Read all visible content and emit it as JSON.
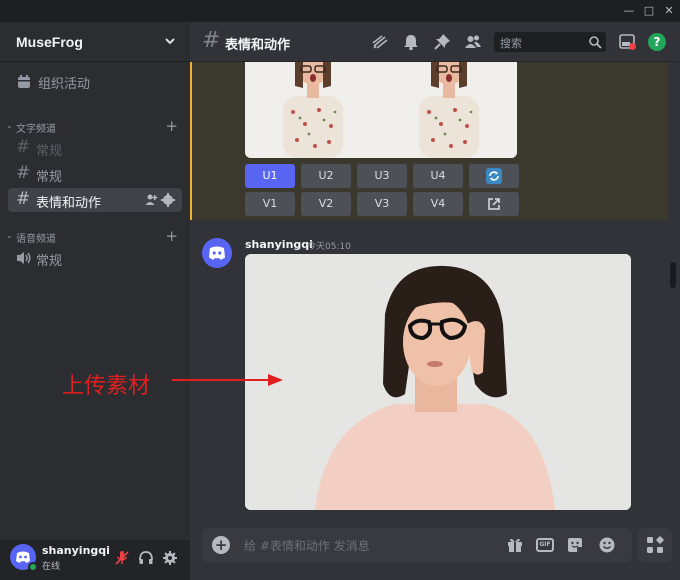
{
  "window": {
    "minimize": "—",
    "maximize": "□",
    "close": "✕"
  },
  "server": {
    "name": "MuseFrog"
  },
  "sidebar": {
    "events_label": "组织活动",
    "text_category": "文字频道",
    "voice_category": "语音频道",
    "text_channels": [
      {
        "name": "常规",
        "state": "muted"
      },
      {
        "name": "常规",
        "state": "normal"
      },
      {
        "name": "表情和动作",
        "state": "active"
      }
    ],
    "voice_channels": [
      {
        "name": "常规"
      }
    ]
  },
  "user": {
    "name": "shanyingqi",
    "status": "在线"
  },
  "channel_header": {
    "hash": "#",
    "name": "表情和动作",
    "search_placeholder": "搜索",
    "help": "?"
  },
  "mj_buttons": {
    "row1": [
      "U1",
      "U2",
      "U3",
      "U4"
    ],
    "row2": [
      "V1",
      "V2",
      "V3",
      "V4"
    ]
  },
  "message": {
    "author": "shanyingqi",
    "time": "今天05:10"
  },
  "annotation": {
    "text": "上传素材"
  },
  "composer": {
    "placeholder": "给 #表情和动作 发消息",
    "gif": "GIF",
    "plus": "+"
  },
  "colors": {
    "accent": "#5865f2",
    "online": "#23a55a",
    "highlight_bar": "#f0b232",
    "annotation": "#e02020"
  }
}
